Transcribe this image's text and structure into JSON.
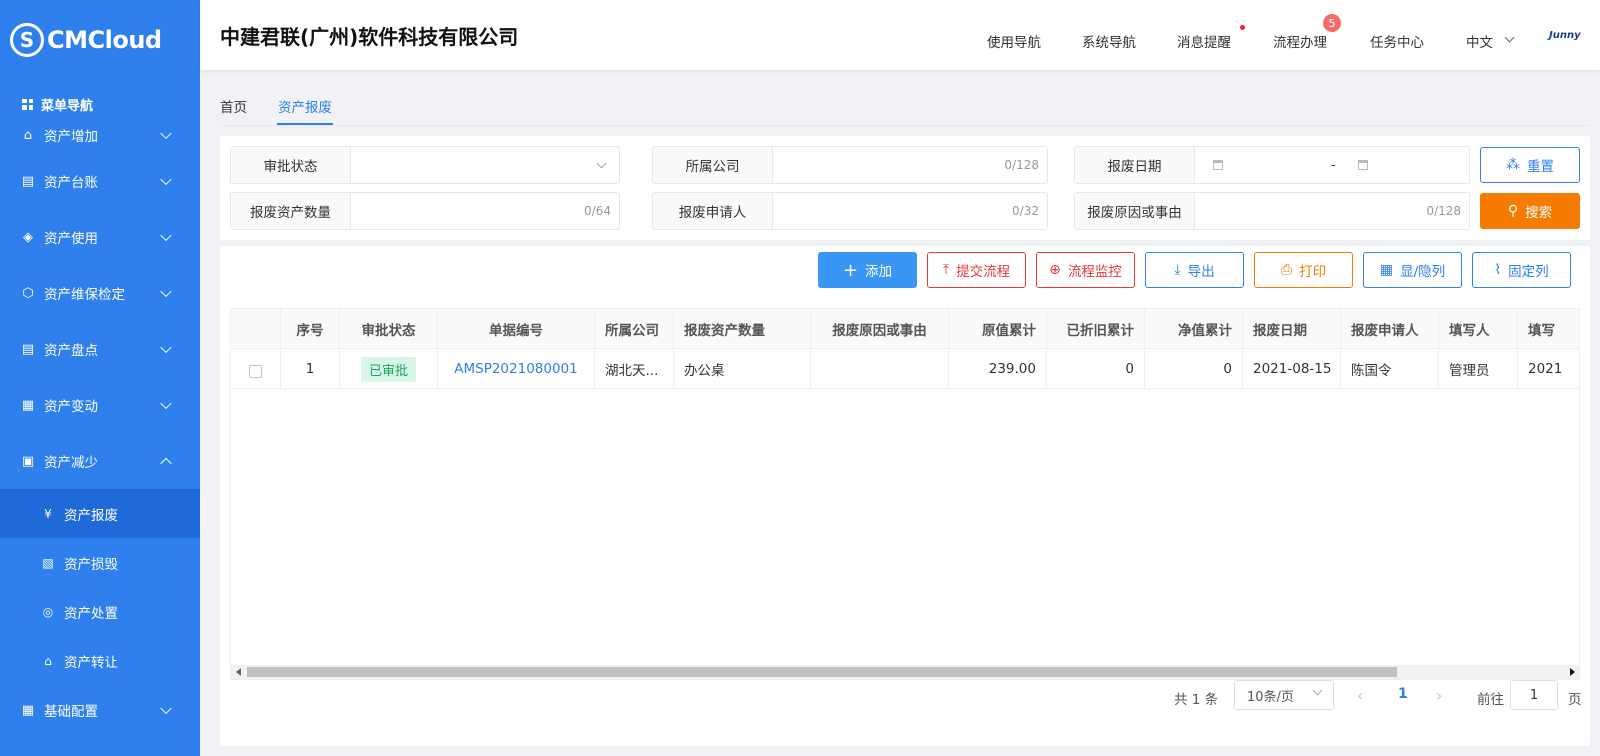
{
  "brand": {
    "logo_letter": "S",
    "logo_text": "CMCloud"
  },
  "sidebar": {
    "heading": "菜单导航",
    "items": [
      {
        "label": "资产增加",
        "icon": "building-icon",
        "expanded": false
      },
      {
        "label": "资产台账",
        "icon": "ledger-icon",
        "expanded": false
      },
      {
        "label": "资产使用",
        "icon": "layers-icon",
        "expanded": false
      },
      {
        "label": "资产维保检定",
        "icon": "cube-icon",
        "expanded": false
      },
      {
        "label": "资产盘点",
        "icon": "ledger-icon",
        "expanded": false
      },
      {
        "label": "资产变动",
        "icon": "grid-icon",
        "expanded": false
      },
      {
        "label": "资产减少",
        "icon": "clipboard-icon",
        "expanded": true
      },
      {
        "label": "基础配置",
        "icon": "grid-icon",
        "expanded": false
      }
    ],
    "sub_items": [
      {
        "label": "资产报废",
        "active": true
      },
      {
        "label": "资产损毁",
        "active": false
      },
      {
        "label": "资产处置",
        "active": false
      },
      {
        "label": "资产转让",
        "active": false
      }
    ]
  },
  "header": {
    "company": "中建君联(广州)软件科技有限公司",
    "nav": [
      "使用导航",
      "系统导航",
      "消息提醒",
      "流程办理",
      "任务中心"
    ],
    "process_badge": "5",
    "language": "中文",
    "brand_mark": "Junny"
  },
  "tabs": [
    "首页",
    "资产报废"
  ],
  "search": {
    "fields": [
      {
        "label": "审批状态",
        "value": ""
      },
      {
        "label": "所属公司",
        "value": "0/128"
      },
      {
        "label": "报废日期",
        "value": ""
      },
      {
        "label": "报废资产数量",
        "value": "0/64"
      },
      {
        "label": "报废申请人",
        "value": "0/32"
      },
      {
        "label": "报废原因或事由",
        "value": "0/128"
      }
    ],
    "date_separator": "-",
    "reset": "重置",
    "search": "搜索"
  },
  "toolbar": {
    "add": "添加",
    "submit_flow": "提交流程",
    "monitor_flow": "流程监控",
    "export": "导出",
    "print": "打印",
    "toggle_columns": "显/隐列",
    "pin_columns": "固定列"
  },
  "table": {
    "columns": [
      "序号",
      "审批状态",
      "单据编号",
      "所属公司",
      "报废资产数量",
      "报废原因或事由",
      "原值累计",
      "已折旧累计",
      "净值累计",
      "报废日期",
      "报废申请人",
      "填写人",
      "填写"
    ],
    "rows": [
      [
        "1",
        "已审批",
        "AMSP2021080001",
        "湖北天...",
        "办公桌",
        "",
        "239.00",
        "0",
        "0",
        "2021-08-15",
        "陈国令",
        "管理员",
        "2021"
      ]
    ]
  },
  "pagination": {
    "total": "共 1 条",
    "page_size": "10条/页",
    "current": "1",
    "goto": "前往",
    "goto_value": "1",
    "page_unit": "页"
  },
  "colors": {
    "primary": "#2f80ed",
    "sidebar_active": "#1f6ad8",
    "danger": "#e53935",
    "warning": "#f57c00",
    "success": "#19a15f"
  }
}
